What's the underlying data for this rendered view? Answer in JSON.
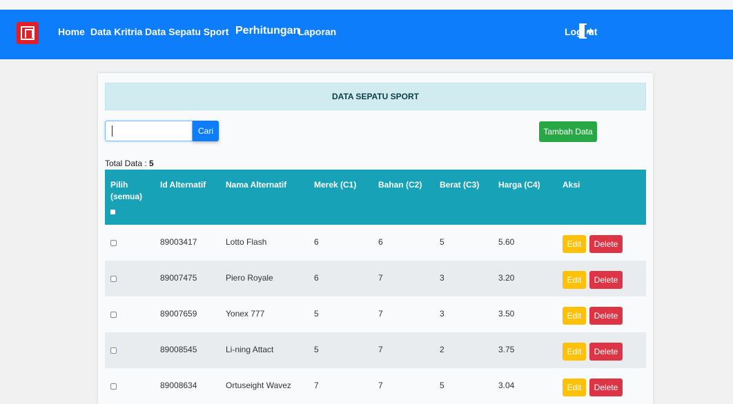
{
  "nav": {
    "items": [
      "Home",
      "Data Kritria",
      "Data Sepatu Sport",
      "Perhitungan",
      "Laporan"
    ],
    "logout": "Logout",
    "logo_icon": "brand-logo-icon",
    "logout_icon": "logout-door-icon"
  },
  "card": {
    "title": "DATA SEPATU SPORT",
    "search_placeholder": "",
    "search_button": "Cari",
    "add_button": "Tambah Data",
    "total_label": "Total Data :",
    "total_value": "5"
  },
  "table": {
    "headers": {
      "select": "Pilih",
      "select_all": "(semua)",
      "id": "Id Alternatif",
      "name": "Nama Alternatif",
      "c1": "Merek (C1)",
      "c2": "Bahan (C2)",
      "c3": "Berat (C3)",
      "c4": "Harga (C4)",
      "action": "Aksi"
    },
    "edit_label": "Edit",
    "delete_label": "Delete",
    "rows": [
      {
        "id": "89003417",
        "name": "Lotto Flash",
        "c1": "6",
        "c2": "6",
        "c3": "5",
        "c4": "5.60"
      },
      {
        "id": "89007475",
        "name": "Piero Royale",
        "c1": "6",
        "c2": "7",
        "c3": "3",
        "c4": "3.20"
      },
      {
        "id": "89007659",
        "name": "Yonex 777",
        "c1": "5",
        "c2": "7",
        "c3": "3",
        "c4": "3.50"
      },
      {
        "id": "89008545",
        "name": "Li-ning Attact",
        "c1": "5",
        "c2": "7",
        "c3": "2",
        "c4": "3.75"
      },
      {
        "id": "89008634",
        "name": "Ortuseight Wavez",
        "c1": "7",
        "c2": "7",
        "c3": "5",
        "c4": "3.04"
      }
    ]
  },
  "colors": {
    "navbar": "#0d7dfc",
    "table_header": "#17a2b8",
    "edit": "#ffc107",
    "delete": "#dc3545",
    "add": "#28a745",
    "logo": "#e31e26"
  }
}
